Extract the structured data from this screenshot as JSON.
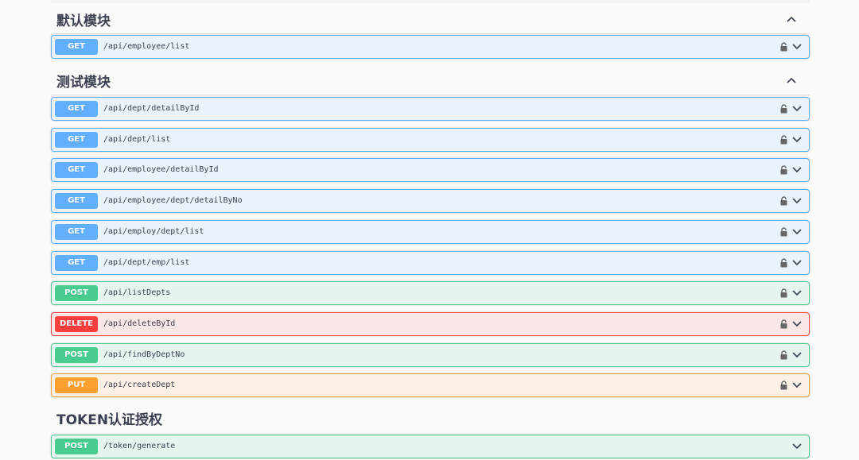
{
  "colors": {
    "get": "#61affe",
    "post": "#49cc90",
    "delete": "#f93e3e",
    "put": "#fca130",
    "text": "#3b4151"
  },
  "sections": [
    {
      "title": "默认模块",
      "operations": [
        {
          "method": "GET",
          "path": "/api/employee/list",
          "locked": true
        }
      ]
    },
    {
      "title": "测试模块",
      "operations": [
        {
          "method": "GET",
          "path": "/api/dept/detailById",
          "locked": true
        },
        {
          "method": "GET",
          "path": "/api/dept/list",
          "locked": true
        },
        {
          "method": "GET",
          "path": "/api/employee/detailById",
          "locked": true
        },
        {
          "method": "GET",
          "path": "/api/employee/dept/detailByNo",
          "locked": true
        },
        {
          "method": "GET",
          "path": "/api/employ/dept/list",
          "locked": true
        },
        {
          "method": "GET",
          "path": "/api/dept/emp/list",
          "locked": true
        },
        {
          "method": "POST",
          "path": "/api/listDepts",
          "locked": true
        },
        {
          "method": "DELETE",
          "path": "/api/deleteById",
          "locked": true
        },
        {
          "method": "POST",
          "path": "/api/findByDeptNo",
          "locked": true
        },
        {
          "method": "PUT",
          "path": "/api/createDept",
          "locked": true
        }
      ]
    },
    {
      "title": "TOKEN认证授权",
      "operations": [
        {
          "method": "POST",
          "path": "/token/generate",
          "locked": false
        }
      ]
    }
  ],
  "icons": {
    "collapse": "chevron-up-icon",
    "expand": "chevron-down-icon",
    "lock": "lock-icon"
  }
}
